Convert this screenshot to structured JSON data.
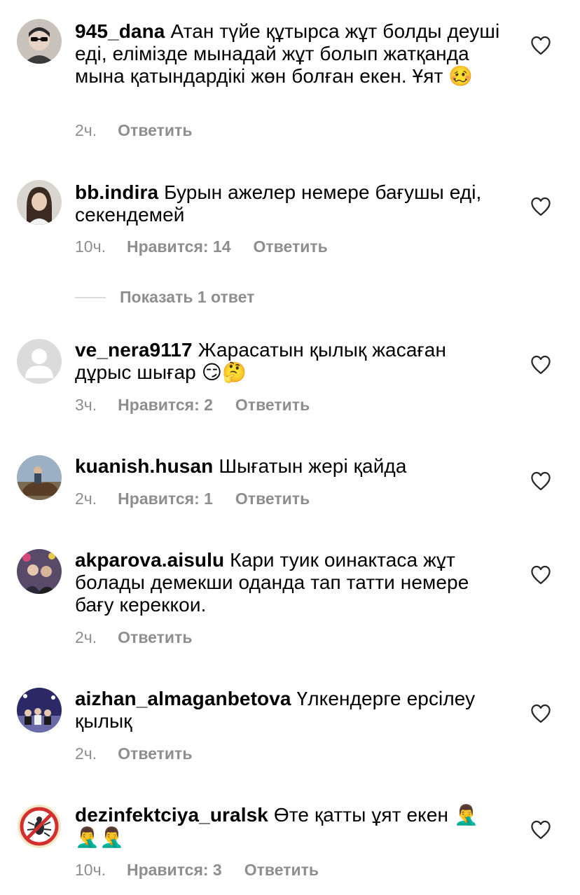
{
  "comments": [
    {
      "username": "945_dana",
      "text": "Атан түйе құтырса жұт болды деуші еді, елімізде мынадай жұт болып жатқанда мына қатындардікі жөн болған екен. Ұят",
      "emoji": "🥴",
      "time": "2ч.",
      "likes": "",
      "reply_label": "Ответить",
      "avatar_icon": "user-photo-avatar"
    },
    {
      "username": "bb.indira",
      "text": "Бурын ажелер немере бағушы еді, секендемей",
      "emoji": "",
      "time": "10ч.",
      "likes": "Нравится: 14",
      "reply_label": "Ответить",
      "avatar_icon": "user-photo-avatar"
    },
    {
      "username": "ve_nera9117",
      "text": "Жарасатын қылық жасаған дұрыс шығар",
      "emoji": "😏🤔",
      "time": "3ч.",
      "likes": "Нравится: 2",
      "reply_label": "Ответить",
      "avatar_icon": "default-avatar"
    },
    {
      "username": "kuanish.husan",
      "text": "Шығатын жері қайда",
      "emoji": "",
      "time": "2ч.",
      "likes": "Нравится: 1",
      "reply_label": "Ответить",
      "avatar_icon": "user-photo-avatar"
    },
    {
      "username": "akparova.aisulu",
      "text": "Кари туик оинактаса жұт болады демекши оданда тап татти немере бағу кереккои.",
      "emoji": "",
      "time": "2ч.",
      "likes": "",
      "reply_label": "Ответить",
      "avatar_icon": "user-photo-avatar"
    },
    {
      "username": "aizhan_almaganbetova",
      "text": "Үлкендерге ерсілеу қылық",
      "emoji": "",
      "time": "2ч.",
      "likes": "",
      "reply_label": "Ответить",
      "avatar_icon": "user-photo-avatar"
    },
    {
      "username": "dezinfektciya_uralsk",
      "text": "Өте қатты ұят екен",
      "emoji": "🤦‍♂️🤦‍♂️🤦‍♂️",
      "time": "10ч.",
      "likes": "Нравится: 3",
      "reply_label": "Ответить",
      "avatar_icon": "no-insects-logo-avatar"
    }
  ],
  "show_replies": {
    "label": "Показать 1 ответ"
  },
  "colors": {
    "text": "#000000",
    "secondary": "#8e8e8e",
    "divider": "#dbdbdb",
    "heart_stroke": "#262626"
  }
}
